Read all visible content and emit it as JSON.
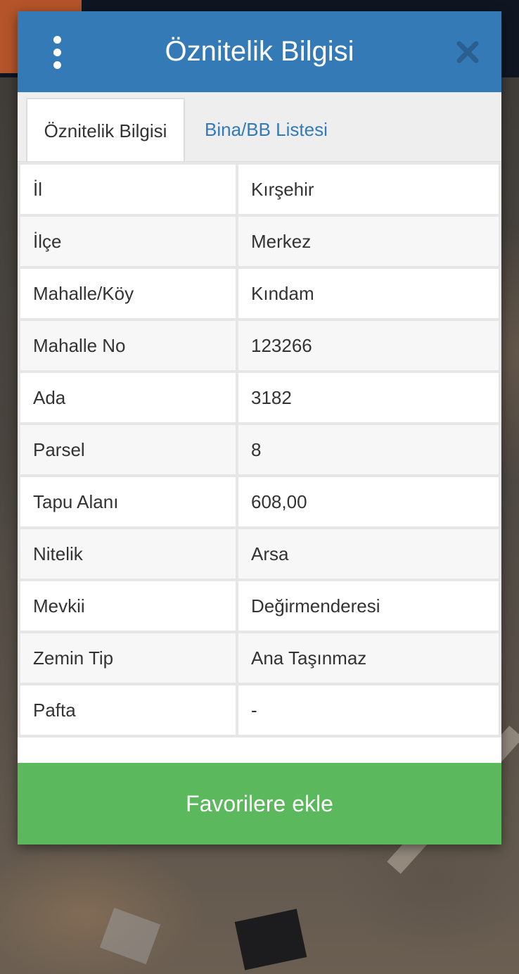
{
  "dialog": {
    "title": "Öznitelik Bilgisi",
    "menu_icon": "vertical-ellipsis-icon",
    "close_icon": "close-icon"
  },
  "tabs": [
    {
      "label": "Öznitelik Bilgisi",
      "active": true
    },
    {
      "label": "Bina/BB Listesi",
      "active": false
    }
  ],
  "attributes": [
    {
      "key": "İl",
      "value": "Kırşehir"
    },
    {
      "key": "İlçe",
      "value": "Merkez"
    },
    {
      "key": "Mahalle/Köy",
      "value": "Kındam"
    },
    {
      "key": "Mahalle No",
      "value": "123266"
    },
    {
      "key": "Ada",
      "value": "3182"
    },
    {
      "key": "Parsel",
      "value": "8"
    },
    {
      "key": "Tapu Alanı",
      "value": "608,00"
    },
    {
      "key": "Nitelik",
      "value": "Arsa"
    },
    {
      "key": "Mevkii",
      "value": "Değirmenderesi"
    },
    {
      "key": "Zemin Tip",
      "value": "Ana Taşınmaz"
    },
    {
      "key": "Pafta",
      "value": "-"
    }
  ],
  "actions": {
    "favorite_label": "Favorilere ekle"
  },
  "colors": {
    "header": "#337ab7",
    "tab_link": "#337ab7",
    "favorite_button": "#5cb85c",
    "close_icon": "#2a5f8f"
  }
}
